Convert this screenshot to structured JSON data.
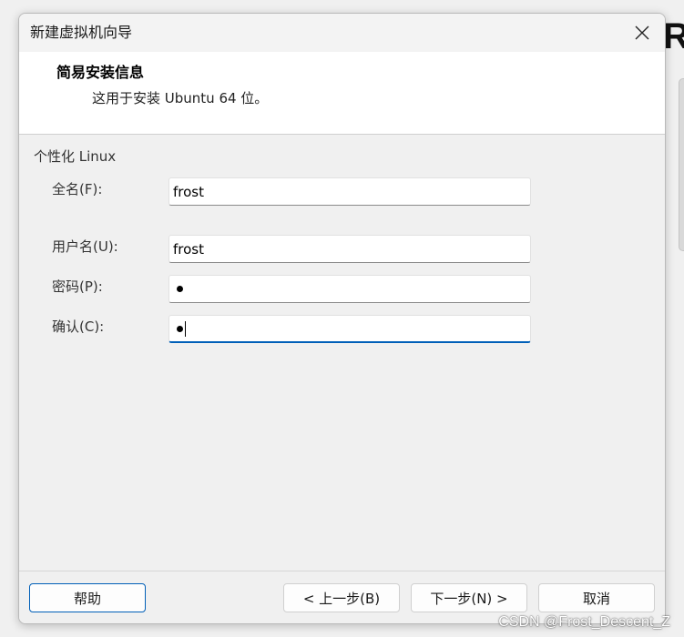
{
  "background": {
    "glyph": "R"
  },
  "dialog": {
    "title": "新建虚拟机向导",
    "close_icon": "close-icon"
  },
  "header": {
    "title": "简易安装信息",
    "subtitle": "这用于安装 Ubuntu 64 位。"
  },
  "form": {
    "group_label": "个性化 Linux",
    "full_name": {
      "label": "全名(F):",
      "value": "frost"
    },
    "username": {
      "label": "用户名(U):",
      "value": "frost"
    },
    "password": {
      "label": "密码(P):",
      "masked_length": 1
    },
    "confirm": {
      "label": "确认(C):",
      "masked_length": 1,
      "focused": true
    }
  },
  "footer": {
    "help_label": "帮助",
    "back_label": "< 上一步(B)",
    "next_label": "下一步(N) >",
    "cancel_label": "取消"
  },
  "watermark": "CSDN @Frost_Descent_Z",
  "colors": {
    "accent": "#005fb8",
    "header_bg": "#ffffff",
    "window_bg": "#f0f0f0"
  }
}
